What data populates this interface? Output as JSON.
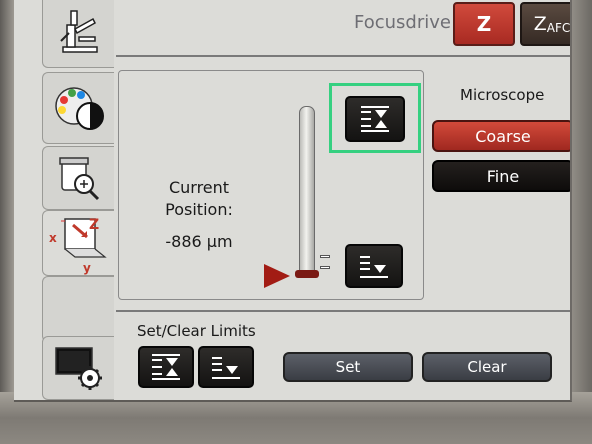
{
  "header": {
    "title": "Focusdrive",
    "z_label": "Z",
    "zafc_main": "Z",
    "zafc_sub": "AFC"
  },
  "tabs": [
    {
      "icon": "microscope-icon"
    },
    {
      "icon": "contrast-palette-icon"
    },
    {
      "icon": "sample-zoom-icon"
    },
    {
      "icon": "xyz-stage-icon",
      "x": "x",
      "y": "y",
      "z": "Z"
    },
    {
      "icon": "blank-tab"
    },
    {
      "icon": "monitor-settings-icon"
    }
  ],
  "position": {
    "label_line1": "Current",
    "label_line2": "Position:",
    "value": "-886 µm"
  },
  "microscope": {
    "label": "Microscope",
    "coarse": "Coarse",
    "fine": "Fine"
  },
  "limits": {
    "label": "Set/Clear Limits",
    "set": "Set",
    "clear": "Clear"
  },
  "colors": {
    "accent_red": "#c0392b",
    "highlight_green": "#35d080"
  }
}
